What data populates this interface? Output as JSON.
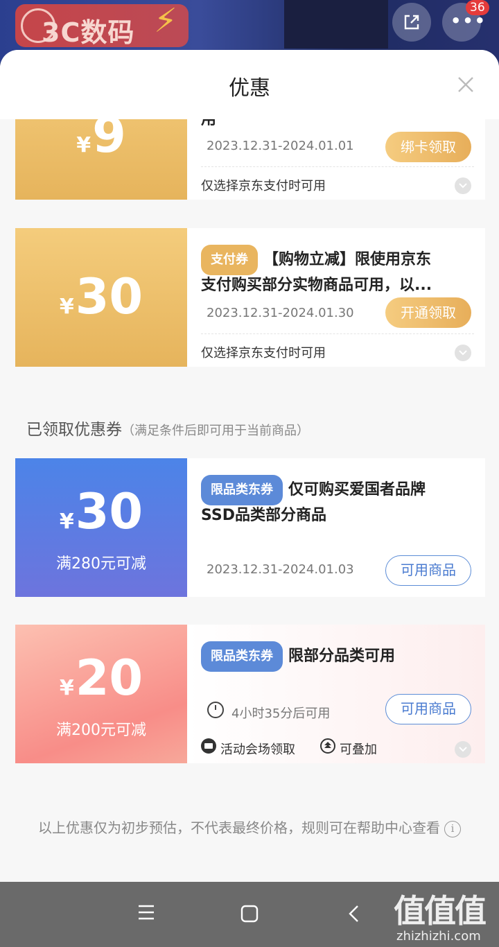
{
  "background": {
    "banner_text": "3C数码",
    "badge_count": "36"
  },
  "sheet": {
    "title": "优惠"
  },
  "available_coupons": [
    {
      "amount": "9",
      "currency": "¥",
      "desc_tail": "用",
      "date": "2023.12.31-2024.01.01",
      "button": "绑卡领取",
      "note": "仅选择京东支付时可用"
    },
    {
      "amount": "30",
      "currency": "¥",
      "tag": "支付券",
      "desc_line1": "【购物立减】限使用京东",
      "desc_line2": "支付购买部分实物商品可用，以...",
      "date": "2023.12.31-2024.01.30",
      "button": "开通领取",
      "note": "仅选择京东支付时可用"
    }
  ],
  "received_section": {
    "title": "已领取优惠券",
    "subtitle": "（满足条件后即可用于当前商品）"
  },
  "received_coupons": [
    {
      "amount": "30",
      "currency": "¥",
      "condition": "满280元可减",
      "tag": "限品类东券",
      "desc_line1": "仅可购买爱国者品牌",
      "desc_line2": "SSD品类部分商品",
      "date": "2023.12.31-2024.01.03",
      "button": "可用商品"
    },
    {
      "amount": "20",
      "currency": "¥",
      "condition": "满200元可减",
      "tag": "限品类东券",
      "desc_line1": "限部分品类可用",
      "timer": "4小时35分后可用",
      "button": "可用商品",
      "source": "活动会场领取",
      "stackable": "可叠加"
    }
  ],
  "footer": {
    "note": "以上优惠仅为初步预估，不代表最终价格，规则可在帮助中心查看"
  },
  "watermark": {
    "big": "值值值",
    "small": "zhizhizhi.com"
  }
}
